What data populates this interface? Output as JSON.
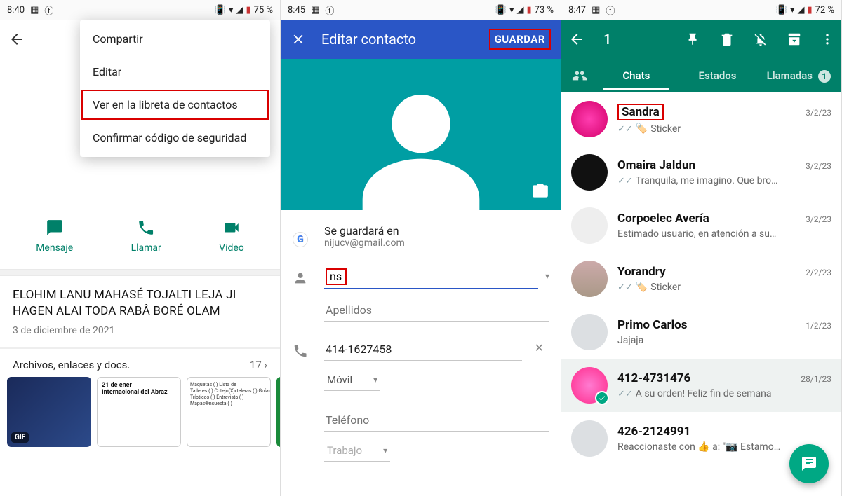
{
  "phone1": {
    "status": {
      "time": "8:40",
      "battery": "75 %"
    },
    "menu": {
      "items": [
        "Compartir",
        "Editar",
        "Ver en la libreta de contactos",
        "Confirmar código de seguridad"
      ],
      "highlighted_index": 2
    },
    "actions": {
      "mensaje": "Mensaje",
      "llamar": "Llamar",
      "video": "Video"
    },
    "broadcast": {
      "title": "ELOHIM LANU MAHASÉ TOJALTI LEJA JI HAGEN ALAI TODA RABÂ BORÉ OLAM",
      "date": "3 de diciembre de 2021"
    },
    "files": {
      "label": "Archivos, enlaces y docs.",
      "count": "17",
      "gif_badge": "GIF"
    }
  },
  "phone2": {
    "status": {
      "time": "8:45",
      "battery": "73 %"
    },
    "appbar": {
      "title": "Editar contacto",
      "save": "GUARDAR"
    },
    "account": {
      "label": "Se guardará en",
      "email": "nijucv@gmail.com"
    },
    "name": {
      "value": "ns",
      "lastname_placeholder": "Apellidos"
    },
    "phone": {
      "number": "414-1627458",
      "type": "Móvil",
      "placeholder2": "Teléfono",
      "type2": "Trabajo"
    }
  },
  "phone3": {
    "status": {
      "time": "8:47",
      "battery": "72 %"
    },
    "selection": {
      "count": "1"
    },
    "tabs": {
      "chats": "Chats",
      "estados": "Estados",
      "llamadas": "Llamadas",
      "llamadas_badge": "1"
    },
    "chats": [
      {
        "name": "Sandra",
        "date": "3/2/23",
        "msg": "Sticker",
        "ticks": true,
        "sticker_icon": true,
        "highlight": true,
        "avatar": "pink"
      },
      {
        "name": "Omaira Jaldun",
        "date": "3/2/23",
        "msg": "Tranquila, me imagino. Que bro…",
        "ticks": true,
        "avatar": "santa"
      },
      {
        "name": "Corpoelec Avería",
        "date": "3/2/23",
        "msg": "Estimado usuario, en atención a su…",
        "avatar": "corp"
      },
      {
        "name": "Yorandry",
        "date": "2/2/23",
        "msg": "Sticker",
        "ticks": true,
        "sticker_icon": true,
        "avatar": "yora"
      },
      {
        "name": "Primo Carlos",
        "date": "1/2/23",
        "msg": "Jajaja",
        "avatar": "grey"
      },
      {
        "name": "412-4731476",
        "date": "28/1/23",
        "msg": "A su orden! Feliz fin de semana",
        "ticks": true,
        "selected": true,
        "avatar": "minnie"
      },
      {
        "name": "426-2124991",
        "date": "",
        "msg": "Reaccionaste con 👍 a: \"📷 Estamo…",
        "avatar": "grey"
      }
    ]
  }
}
